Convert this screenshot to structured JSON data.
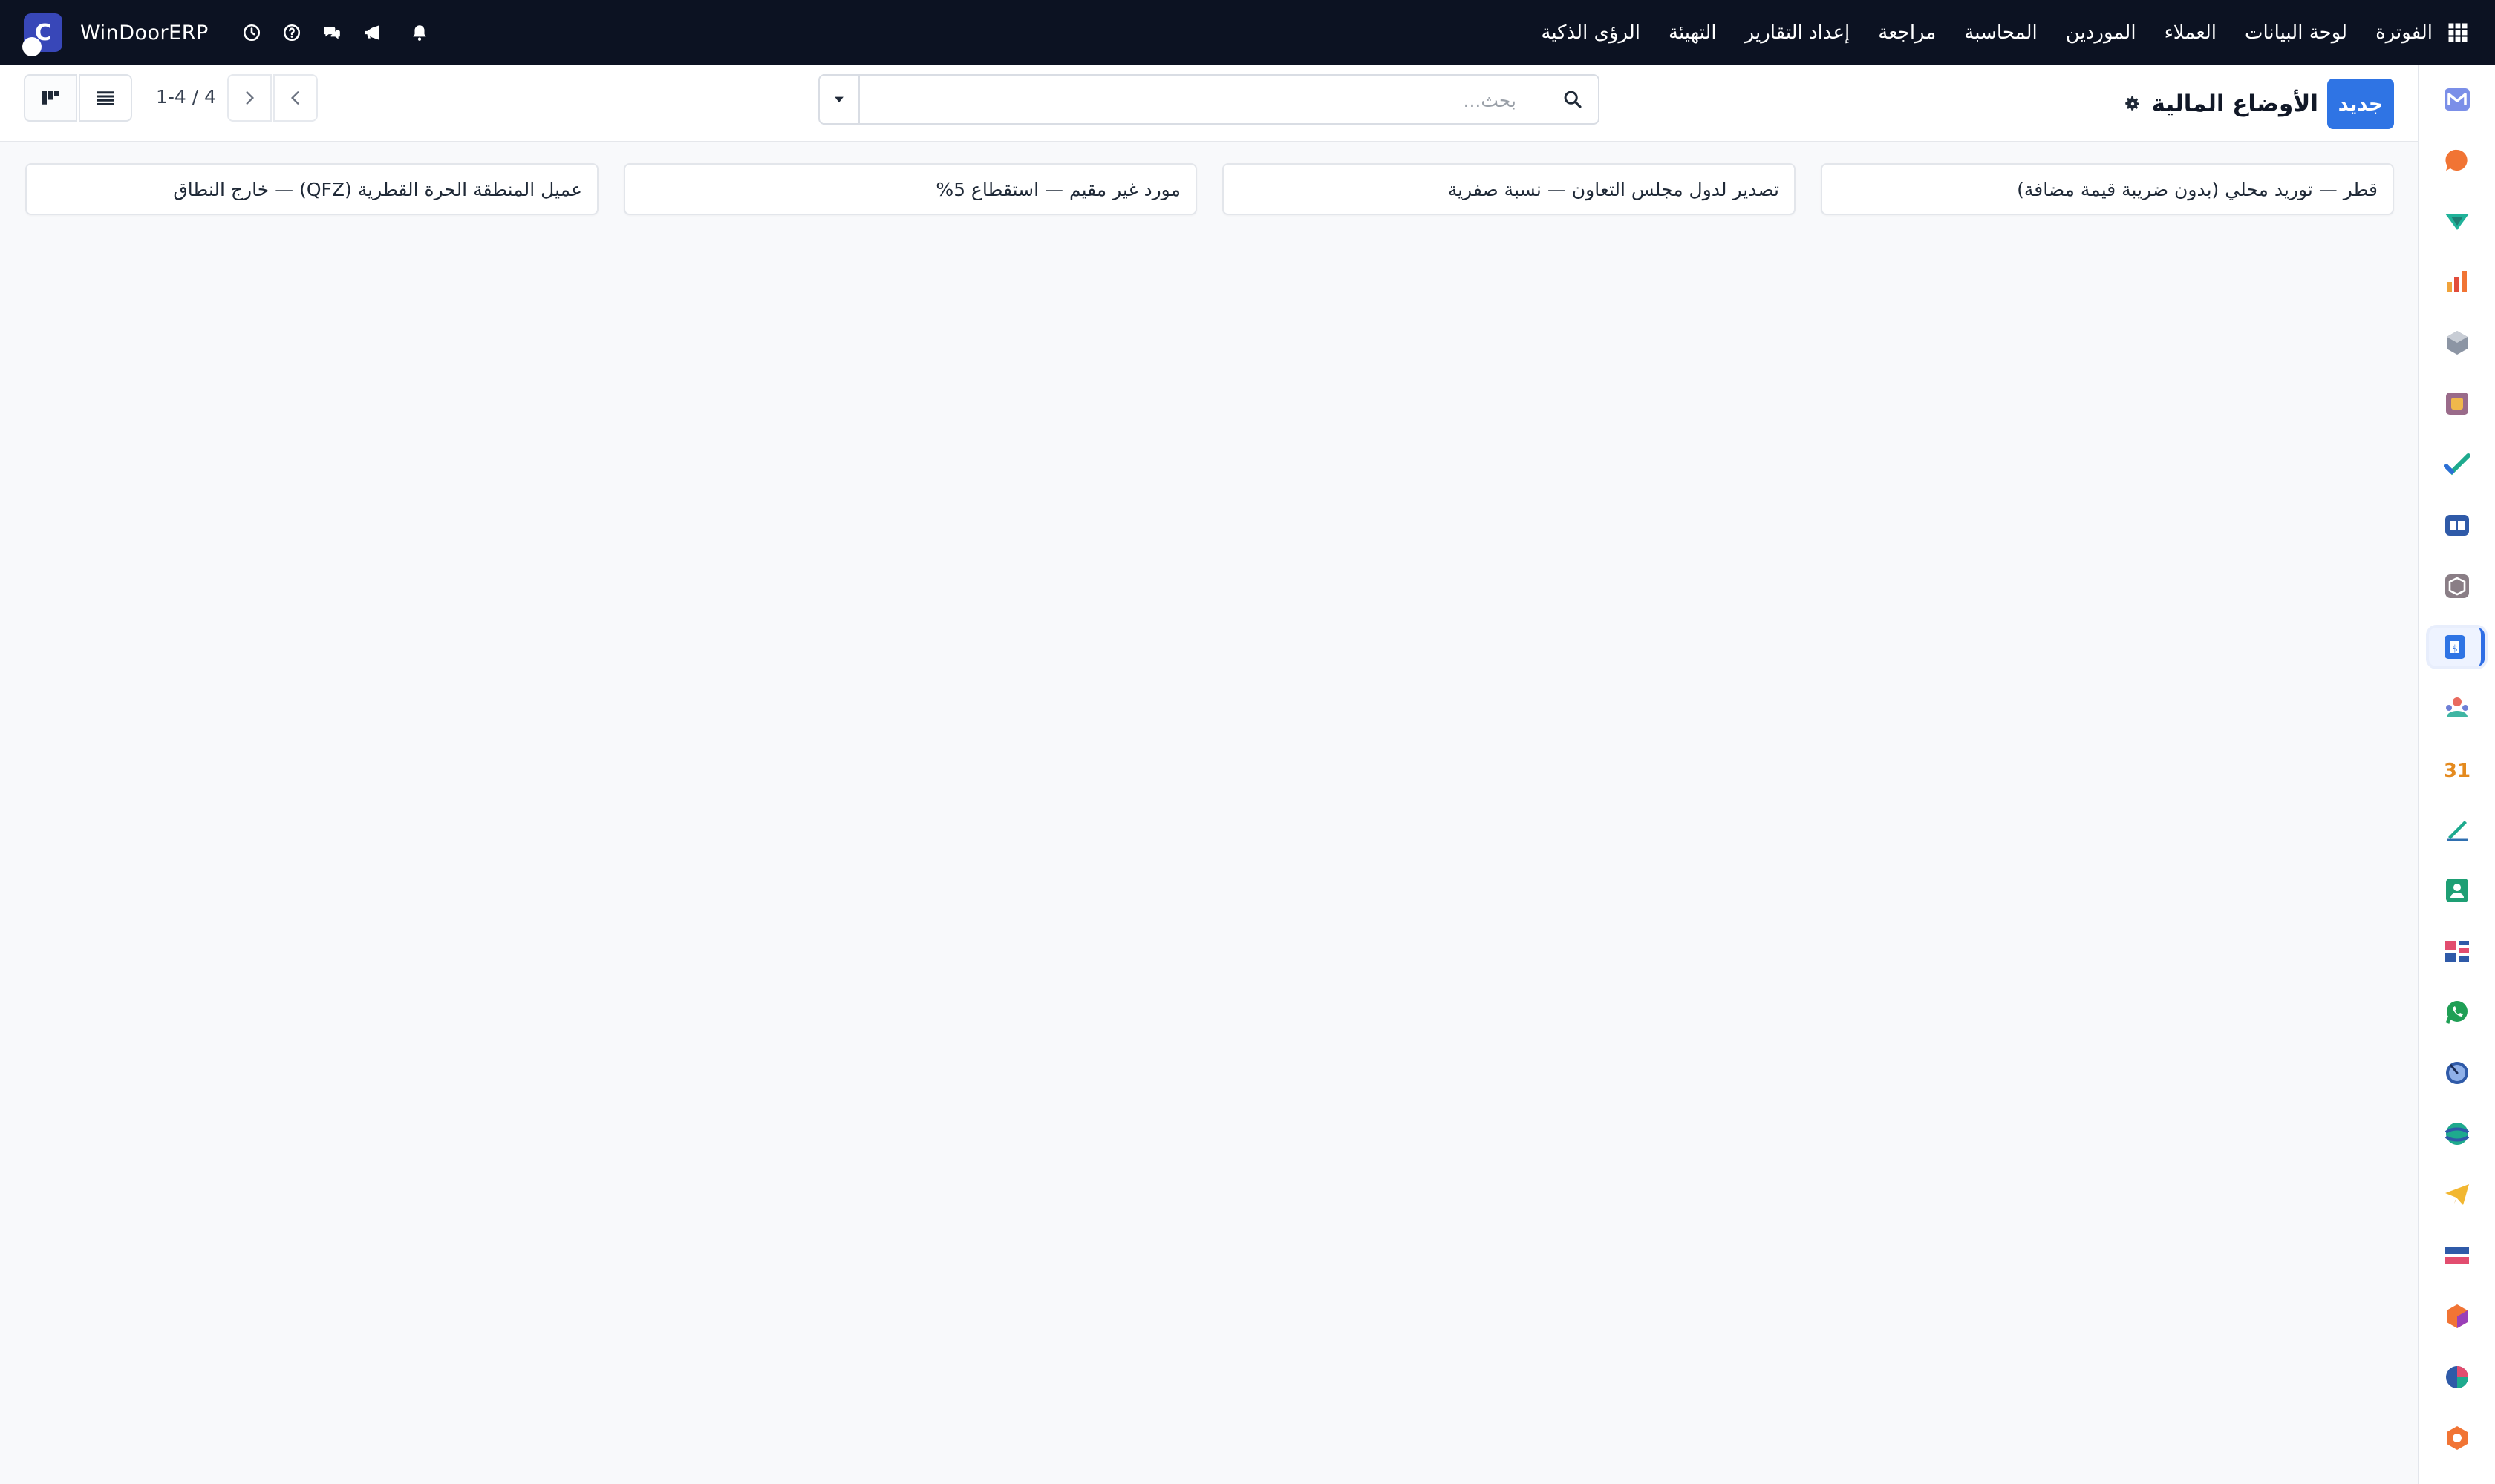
{
  "navbar": {
    "brand": "WinDoorERP",
    "brand_initial": "C",
    "menu": [
      "الفوترة",
      "لوحة البيانات",
      "العملاء",
      "الموردين",
      "المحاسبة",
      "مراجعة",
      "إعداد التقارير",
      "التهيئة",
      "الرؤى الذكية"
    ]
  },
  "control_panel": {
    "new_button": "جديد",
    "title": "الأوضاع المالية",
    "search_placeholder": "بحث...",
    "pager": "1-4 / 4"
  },
  "records": [
    "قطر — توريد محلي (بدون ضريبة قيمة مضافة)",
    "تصدير لدول مجلس التعاون — نسبة صفرية",
    "مورد غير مقيم — استقطاع 5%",
    "عميل المنطقة الحرة القطرية (QFZ) — خارج النطاق"
  ],
  "rail_apps": [
    "gmail-icon",
    "discuss-icon",
    "sign-icon",
    "reports-icon",
    "inventory-icon",
    "products-icon",
    "todo-icon",
    "knowledge-icon",
    "packages-icon",
    "accounting-icon",
    "employees-icon",
    "calendar-icon",
    "sketch-icon",
    "contacts-icon",
    "dashboards-icon",
    "whatsapp-icon",
    "timer-icon",
    "website-icon",
    "telegram-icon",
    "cards-icon",
    "modules-icon",
    "pie-icon",
    "settings-icon"
  ],
  "colors": {
    "navbar_bg": "#0c1222",
    "primary": "#2f74e4",
    "page_bg": "#f8f9fb"
  }
}
